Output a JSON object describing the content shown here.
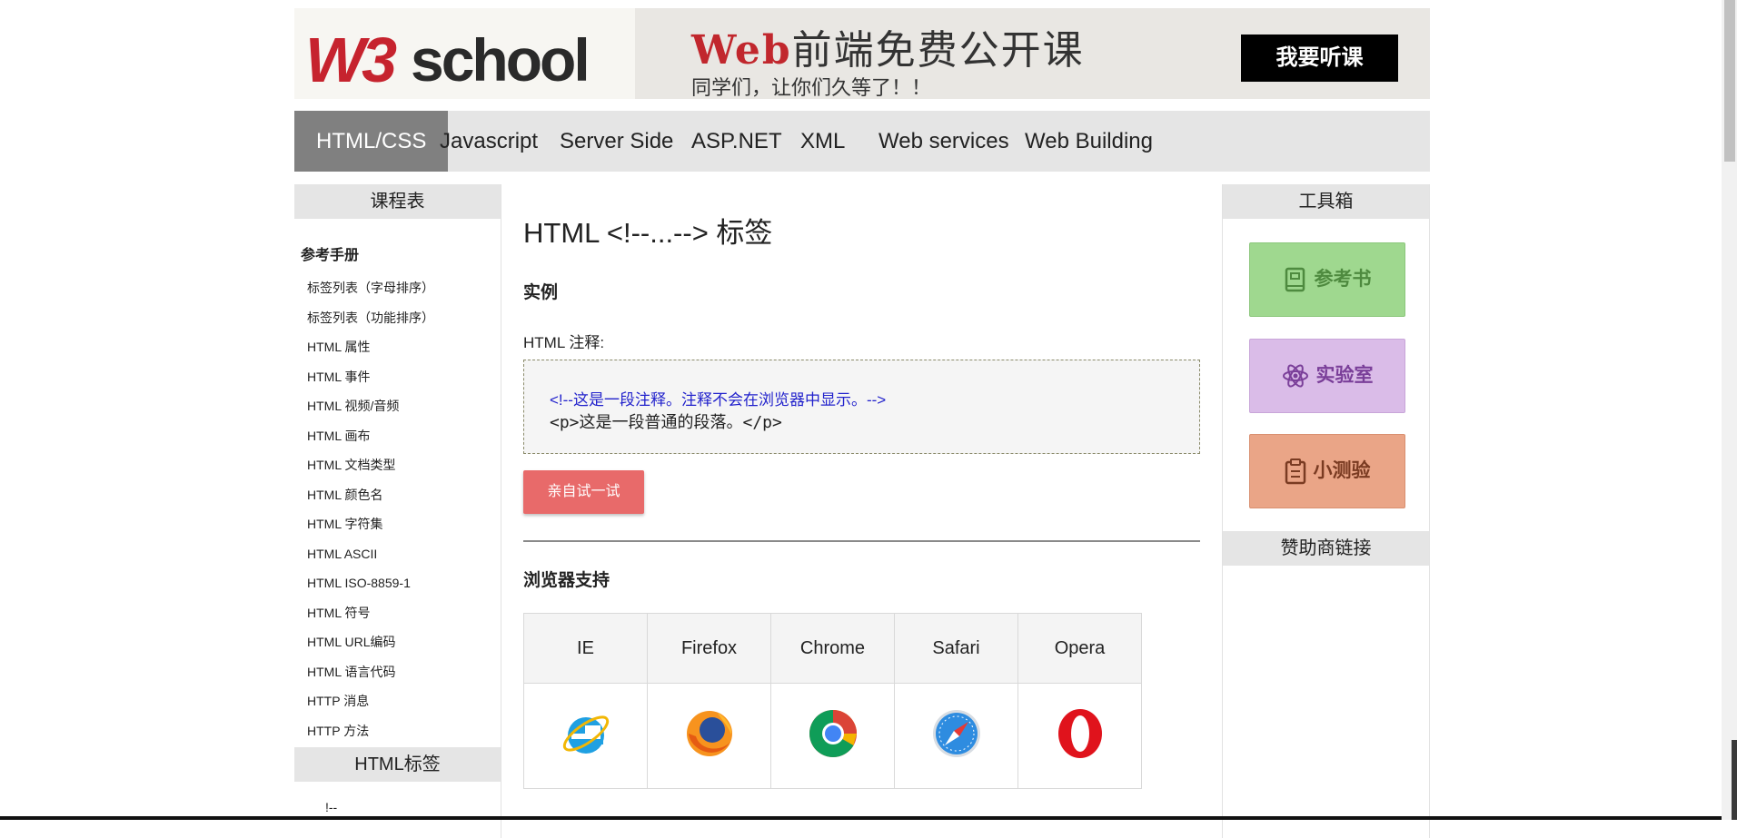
{
  "header": {
    "logo_w3": "W3",
    "logo_school": "school",
    "banner_web": "Web",
    "banner_title_rest": "前端免费公开课",
    "banner_subtitle": "同学们，让你们久等了！！",
    "banner_button": "我要听课"
  },
  "nav": {
    "items": [
      "HTML/CSS",
      "Javascript",
      "Server Side",
      "ASP.NET",
      "XML",
      "Web services",
      "Web Building"
    ],
    "active": "HTML/CSS"
  },
  "left": {
    "heading": "课程表",
    "subheading": "参考手册",
    "links": [
      "标签列表（字母排序）",
      "标签列表（功能排序）",
      "HTML 属性",
      "HTML 事件",
      "HTML 视频/音频",
      "HTML 画布",
      "HTML 文档类型",
      "HTML 颜色名",
      "HTML 字符集",
      "HTML ASCII",
      "HTML ISO-8859-1",
      "HTML 符号",
      "HTML URL编码",
      "HTML 语言代码",
      "HTTP 消息",
      "HTTP 方法"
    ],
    "heading2": "HTML标签",
    "tag_first": "!--"
  },
  "main": {
    "title": "HTML <!--...--> 标签",
    "example_heading": "实例",
    "example_label": "HTML 注释:",
    "code_comment": "<!--这是一段注释。注释不会在浏览器中显示。-->",
    "code_para": "<p>这是一段普通的段落。</p>",
    "try_button": "亲自试一试",
    "support_heading": "浏览器支持",
    "browsers": [
      "IE",
      "Firefox",
      "Chrome",
      "Safari",
      "Opera"
    ],
    "browser_icons": [
      "ie-icon",
      "firefox-icon",
      "chrome-icon",
      "safari-icon",
      "opera-icon"
    ]
  },
  "right": {
    "heading": "工具箱",
    "tools": [
      "参考书",
      "实验室",
      "小测验"
    ],
    "tool_icons": [
      "book-icon",
      "atom-icon",
      "clipboard-icon"
    ],
    "sponsor_heading": "赞助商链接"
  },
  "colors": {
    "brand_red": "#c6232e",
    "nav_active": "#808080",
    "try_button": "#e86a6a",
    "comment_blue": "#2222cc"
  }
}
